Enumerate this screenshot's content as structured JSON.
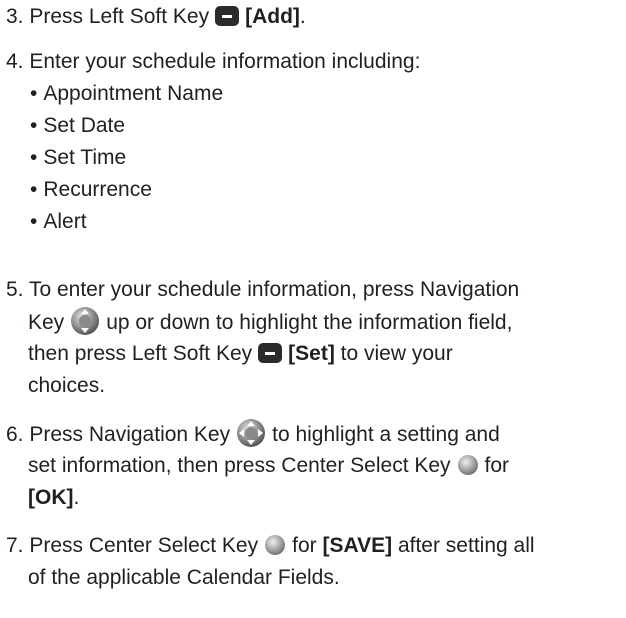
{
  "step3": {
    "prefix": "3. Press Left Soft Key",
    "key": "[Add]",
    "suffix": "."
  },
  "step4": {
    "text": "4. Enter your schedule information including:",
    "bullets": [
      "Appointment Name",
      "Set Date",
      "Set Time",
      "Recurrence",
      "Alert"
    ]
  },
  "step5": {
    "line1": "5. To enter your schedule information, press Navigation",
    "line2_a": "Key",
    "line2_b": "up or down to highlight the information field,",
    "line3_a": "then press Left Soft Key",
    "line3_key": "[Set]",
    "line3_b": "to view your",
    "line4": "choices."
  },
  "step6": {
    "line1_a": "6. Press Navigation Key",
    "line1_b": "to highlight a setting and",
    "line2_a": "set information, then press Center Select Key",
    "line2_b": "for",
    "line3_key": "[OK]",
    "line3_b": "."
  },
  "step7": {
    "line1_a": "7. Press Center Select Key",
    "line1_b": "for",
    "line1_key": "[SAVE]",
    "line1_c": "after setting all",
    "line2": "of the applicable Calendar Fields."
  },
  "icons": {
    "left_soft_key": "left-soft-key-icon",
    "navigation_key_vertical": "navigation-key-updown-icon",
    "navigation_key_4way": "navigation-key-4way-icon",
    "center_select_key": "center-select-key-icon"
  }
}
